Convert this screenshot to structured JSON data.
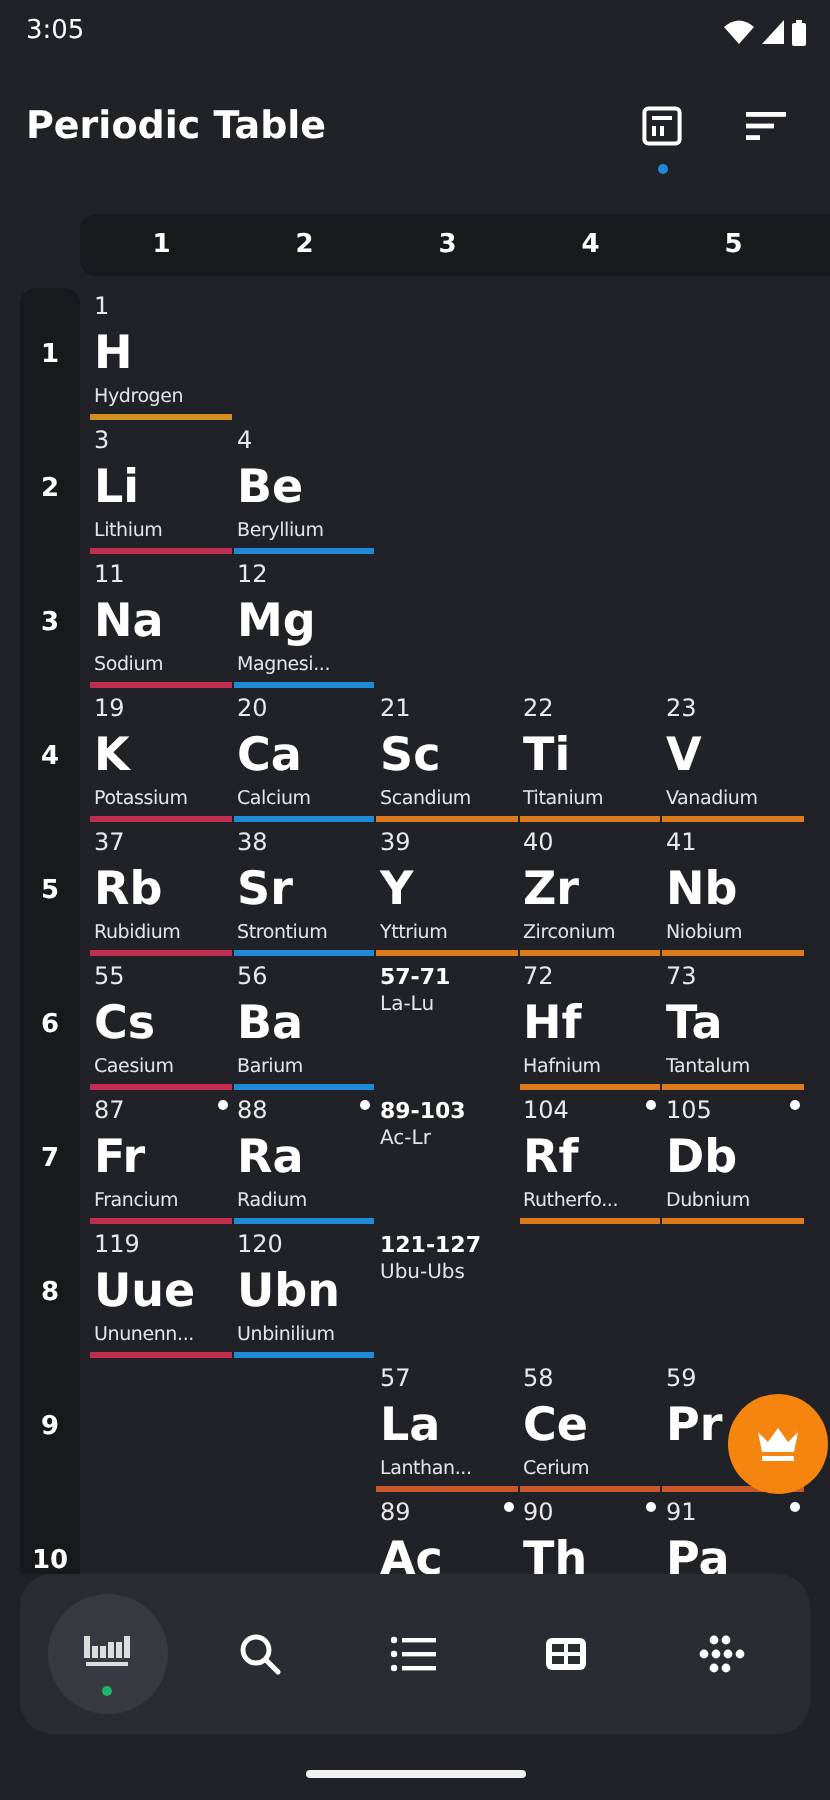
{
  "status_bar": {
    "time": "3:05"
  },
  "app_bar": {
    "title": "Periodic Table",
    "actions": [
      {
        "kind": "table",
        "indicator": true
      },
      {
        "kind": "sort",
        "indicator": false
      }
    ]
  },
  "groups": [
    "1",
    "2",
    "3",
    "4",
    "5"
  ],
  "periods": [
    {
      "label": "1",
      "cells": [
        {
          "kind": "element",
          "number": "1",
          "symbol": "H",
          "name": "Hydrogen",
          "color": "#d38f22",
          "radioactive": false
        },
        {
          "kind": "empty"
        },
        {
          "kind": "empty"
        },
        {
          "kind": "empty"
        },
        {
          "kind": "empty"
        }
      ]
    },
    {
      "label": "2",
      "cells": [
        {
          "kind": "element",
          "number": "3",
          "symbol": "Li",
          "name": "Lithium",
          "color": "#c42d52",
          "radioactive": false
        },
        {
          "kind": "element",
          "number": "4",
          "symbol": "Be",
          "name": "Beryllium",
          "color": "#1f8ad6",
          "radioactive": false
        },
        {
          "kind": "empty"
        },
        {
          "kind": "empty"
        },
        {
          "kind": "empty"
        }
      ]
    },
    {
      "label": "3",
      "cells": [
        {
          "kind": "element",
          "number": "11",
          "symbol": "Na",
          "name": "Sodium",
          "color": "#c42d52",
          "radioactive": false
        },
        {
          "kind": "element",
          "number": "12",
          "symbol": "Mg",
          "name": "Magnesi...",
          "color": "#1f8ad6",
          "radioactive": false
        },
        {
          "kind": "empty"
        },
        {
          "kind": "empty"
        },
        {
          "kind": "empty"
        }
      ]
    },
    {
      "label": "4",
      "cells": [
        {
          "kind": "element",
          "number": "19",
          "symbol": "K",
          "name": "Potassium",
          "color": "#c42d52",
          "radioactive": false
        },
        {
          "kind": "element",
          "number": "20",
          "symbol": "Ca",
          "name": "Calcium",
          "color": "#1f8ad6",
          "radioactive": false
        },
        {
          "kind": "element",
          "number": "21",
          "symbol": "Sc",
          "name": "Scandium",
          "color": "#dc7a1e",
          "radioactive": false
        },
        {
          "kind": "element",
          "number": "22",
          "symbol": "Ti",
          "name": "Titanium",
          "color": "#dc7a1e",
          "radioactive": false
        },
        {
          "kind": "element",
          "number": "23",
          "symbol": "V",
          "name": "Vanadium",
          "color": "#dc7a1e",
          "radioactive": false
        }
      ]
    },
    {
      "label": "5",
      "cells": [
        {
          "kind": "element",
          "number": "37",
          "symbol": "Rb",
          "name": "Rubidium",
          "color": "#c42d52",
          "radioactive": false
        },
        {
          "kind": "element",
          "number": "38",
          "symbol": "Sr",
          "name": "Strontium",
          "color": "#1f8ad6",
          "radioactive": false
        },
        {
          "kind": "element",
          "number": "39",
          "symbol": "Y",
          "name": "Yttrium",
          "color": "#dc7a1e",
          "radioactive": false
        },
        {
          "kind": "element",
          "number": "40",
          "symbol": "Zr",
          "name": "Zirconium",
          "color": "#dc7a1e",
          "radioactive": false
        },
        {
          "kind": "element",
          "number": "41",
          "symbol": "Nb",
          "name": "Niobium",
          "color": "#dc7a1e",
          "radioactive": false
        }
      ]
    },
    {
      "label": "6",
      "cells": [
        {
          "kind": "element",
          "number": "55",
          "symbol": "Cs",
          "name": "Caesium",
          "color": "#c42d52",
          "radioactive": false
        },
        {
          "kind": "element",
          "number": "56",
          "symbol": "Ba",
          "name": "Barium",
          "color": "#1f8ad6",
          "radioactive": false
        },
        {
          "kind": "range",
          "range": "57-71",
          "series": "La-Lu"
        },
        {
          "kind": "element",
          "number": "72",
          "symbol": "Hf",
          "name": "Hafnium",
          "color": "#dc7a1e",
          "radioactive": false
        },
        {
          "kind": "element",
          "number": "73",
          "symbol": "Ta",
          "name": "Tantalum",
          "color": "#dc7a1e",
          "radioactive": false
        }
      ]
    },
    {
      "label": "7",
      "cells": [
        {
          "kind": "element",
          "number": "87",
          "symbol": "Fr",
          "name": "Francium",
          "color": "#c42d52",
          "radioactive": true
        },
        {
          "kind": "element",
          "number": "88",
          "symbol": "Ra",
          "name": "Radium",
          "color": "#1f8ad6",
          "radioactive": true
        },
        {
          "kind": "range",
          "range": "89-103",
          "series": "Ac-Lr"
        },
        {
          "kind": "element",
          "number": "104",
          "symbol": "Rf",
          "name": "Rutherfo...",
          "color": "#dc7a1e",
          "radioactive": true
        },
        {
          "kind": "element",
          "number": "105",
          "symbol": "Db",
          "name": "Dubnium",
          "color": "#dc7a1e",
          "radioactive": true
        }
      ]
    },
    {
      "label": "8",
      "cells": [
        {
          "kind": "element",
          "number": "119",
          "symbol": "Uue",
          "name": "Ununenn...",
          "color": "#c42d52",
          "radioactive": false
        },
        {
          "kind": "element",
          "number": "120",
          "symbol": "Ubn",
          "name": "Unbinilium",
          "color": "#1f8ad6",
          "radioactive": false
        },
        {
          "kind": "range",
          "range": "121-127",
          "series": "Ubu-Ubs"
        },
        {
          "kind": "empty"
        },
        {
          "kind": "empty"
        }
      ]
    },
    {
      "label": "9",
      "cells": [
        {
          "kind": "empty"
        },
        {
          "kind": "empty"
        },
        {
          "kind": "element",
          "number": "57",
          "symbol": "La",
          "name": "Lanthan...",
          "color": "#c9572a",
          "radioactive": false
        },
        {
          "kind": "element",
          "number": "58",
          "symbol": "Ce",
          "name": "Cerium",
          "color": "#c9572a",
          "radioactive": false
        },
        {
          "kind": "element",
          "number": "59",
          "symbol": "Pr",
          "color": "#c9572a",
          "radioactive": false
        }
      ]
    },
    {
      "label": "10",
      "cells": [
        {
          "kind": "empty"
        },
        {
          "kind": "empty"
        },
        {
          "kind": "element",
          "number": "89",
          "symbol": "Ac",
          "radioactive": true
        },
        {
          "kind": "element",
          "number": "90",
          "symbol": "Th",
          "radioactive": true
        },
        {
          "kind": "element",
          "number": "91",
          "symbol": "Pa",
          "radioactive": true
        }
      ]
    }
  ],
  "bottom_nav": [
    {
      "kind": "table",
      "selected": true
    },
    {
      "kind": "search",
      "selected": false
    },
    {
      "kind": "list",
      "selected": false
    },
    {
      "kind": "grid",
      "selected": false
    },
    {
      "kind": "dots",
      "selected": false
    }
  ]
}
